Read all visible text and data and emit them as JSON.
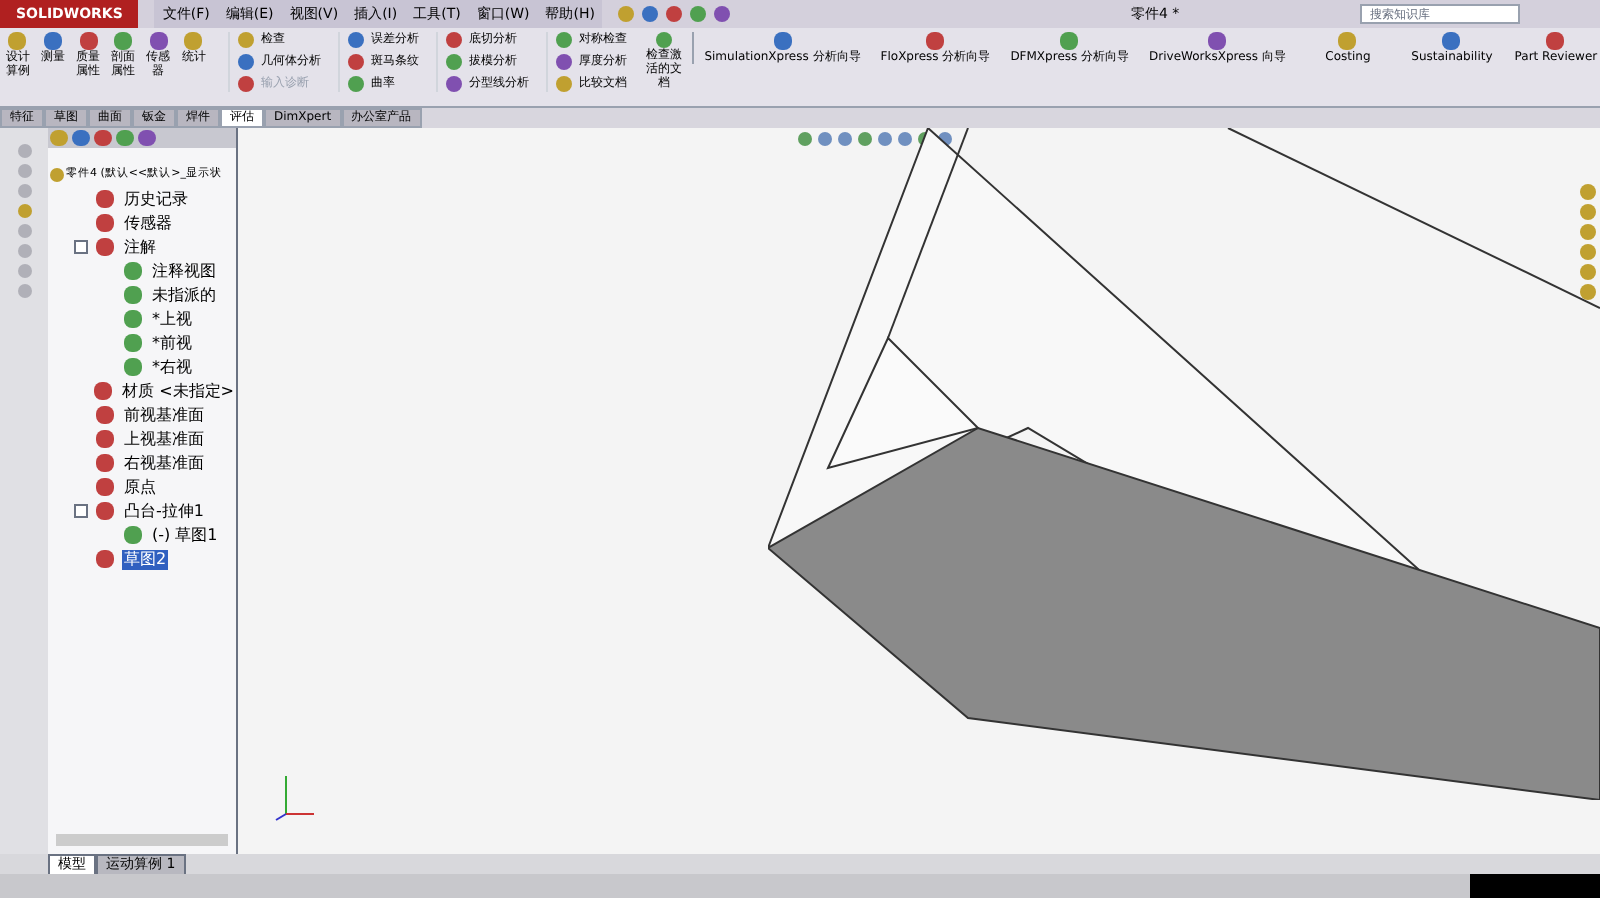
{
  "app": {
    "logo": "SOLIDWORKS",
    "title": "零件4 *"
  },
  "menu": [
    "文件(F)",
    "编辑(E)",
    "视图(V)",
    "插入(I)",
    "工具(T)",
    "窗口(W)",
    "帮助(H)"
  ],
  "search": {
    "placeholder": "搜索知识库"
  },
  "ribbon": {
    "large_left": [
      {
        "label": "设计算例"
      },
      {
        "label": "测量"
      },
      {
        "label": "质量属性"
      },
      {
        "label": "剖面属性"
      },
      {
        "label": "传感器"
      },
      {
        "label": "统计"
      }
    ],
    "small_columns": [
      [
        {
          "label": "检查",
          "disabled": false
        },
        {
          "label": "几何体分析",
          "disabled": false
        },
        {
          "label": "输入诊断",
          "disabled": true
        }
      ],
      [
        {
          "label": "误差分析",
          "disabled": false
        },
        {
          "label": "斑马条纹",
          "disabled": false
        },
        {
          "label": "曲率",
          "disabled": false
        }
      ],
      [
        {
          "label": "底切分析",
          "disabled": false
        },
        {
          "label": "拔模分析",
          "disabled": false
        },
        {
          "label": "分型线分析",
          "disabled": false
        }
      ],
      [
        {
          "label": "对称检查",
          "disabled": false
        },
        {
          "label": "厚度分析",
          "disabled": false
        },
        {
          "label": "比较文档",
          "disabled": false
        }
      ]
    ],
    "check_button": "检查激活的文档",
    "large_right": [
      {
        "label": "SimulationXpress 分析向导"
      },
      {
        "label": "FloXpress 分析向导"
      },
      {
        "label": "DFMXpress 分析向导"
      },
      {
        "label": "DriveWorksXpress 向导"
      },
      {
        "label": "Costing"
      },
      {
        "label": "Sustainability"
      },
      {
        "label": "Part Reviewer"
      }
    ]
  },
  "tabs": [
    {
      "label": "特征",
      "selected": false
    },
    {
      "label": "草图",
      "selected": false
    },
    {
      "label": "曲面",
      "selected": false
    },
    {
      "label": "钣金",
      "selected": false
    },
    {
      "label": "焊件",
      "selected": false
    },
    {
      "label": "评估",
      "selected": true
    },
    {
      "label": "DimXpert",
      "selected": false
    },
    {
      "label": "办公室产品",
      "selected": false
    }
  ],
  "tree": {
    "root": "零件4 (默认<<默认>_显示状",
    "items": [
      {
        "label": "历史记录",
        "selected": false
      },
      {
        "label": "传感器",
        "selected": false
      },
      {
        "label": "注解",
        "selected": false,
        "expanded": true,
        "children": [
          {
            "label": "注释视图",
            "selected": false
          },
          {
            "label": "未指派的",
            "selected": false
          },
          {
            "label": "*上视",
            "selected": false
          },
          {
            "label": "*前视",
            "selected": false
          },
          {
            "label": "*右视",
            "selected": false
          }
        ]
      },
      {
        "label": "材质 <未指定>",
        "selected": false
      },
      {
        "label": "前视基准面",
        "selected": false
      },
      {
        "label": "上视基准面",
        "selected": false
      },
      {
        "label": "右视基准面",
        "selected": false
      },
      {
        "label": "原点",
        "selected": false
      },
      {
        "label": "凸台-拉伸1",
        "selected": false,
        "expanded": true,
        "children": [
          {
            "label": "(-) 草图1",
            "selected": false
          }
        ]
      },
      {
        "label": "草图2",
        "selected": true
      }
    ]
  },
  "bottom_tabs": [
    {
      "label": "模型",
      "selected": true
    },
    {
      "label": "运动算例 1",
      "selected": false
    }
  ]
}
